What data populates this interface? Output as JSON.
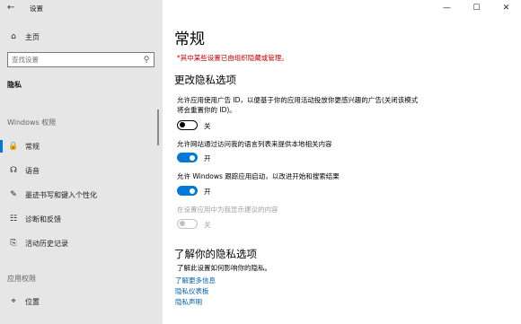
{
  "window": {
    "title": "设置",
    "back_glyph": "←",
    "minimize_glyph": "—",
    "maximize_glyph": "☐",
    "close_glyph": "✕"
  },
  "sidebar": {
    "home": {
      "label": "主页",
      "icon": "home-icon",
      "glyph": "⌂"
    },
    "search": {
      "placeholder": "查找设置",
      "icon": "search-icon",
      "glyph": "⚲"
    },
    "current_section": "隐私",
    "windows_permissions_header": "Windows 权限",
    "windows_items": [
      {
        "label": "常规",
        "icon": "lock-icon",
        "glyph": "🔒",
        "active": true
      },
      {
        "label": "语音",
        "icon": "speech-icon",
        "glyph": "☊",
        "active": false
      },
      {
        "label": "墨迹书写和键入个性化",
        "icon": "pen-keyboard-icon",
        "glyph": "✎",
        "active": false
      },
      {
        "label": "诊断和反馈",
        "icon": "diagnostics-icon",
        "glyph": "☷",
        "active": false
      },
      {
        "label": "活动历史记录",
        "icon": "history-icon",
        "glyph": "⎘",
        "active": false
      }
    ],
    "app_permissions_header": "应用权限",
    "app_items": [
      {
        "label": "位置",
        "icon": "location-icon",
        "glyph": "⌖"
      }
    ]
  },
  "main": {
    "title": "常规",
    "warning": "*其中某些设置已由组织隐藏或管理。",
    "section1_title": "更改隐私选项",
    "options": [
      {
        "text": "允许应用使用广告 ID，以便基于你的应用活动投放你更感兴趣的广告(关闭该模式将会重置你的 ID)。",
        "state": "关",
        "on": false,
        "disabled": false
      },
      {
        "text": "允许网站通过访问我的语言列表来提供本地相关内容",
        "state": "开",
        "on": true,
        "disabled": false
      },
      {
        "text": "允许 Windows 跟踪应用启动，以改进开始和搜索结果",
        "state": "开",
        "on": true,
        "disabled": false
      },
      {
        "text": "在设置应用中为我显示建议的内容",
        "state": "关",
        "on": false,
        "disabled": true
      }
    ],
    "section2_title": "了解你的隐私选项",
    "section2_desc": "了解此设置如何影响你的隐私。",
    "links": [
      "了解更多信息",
      "隐私仪表板",
      "隐私声明"
    ]
  }
}
